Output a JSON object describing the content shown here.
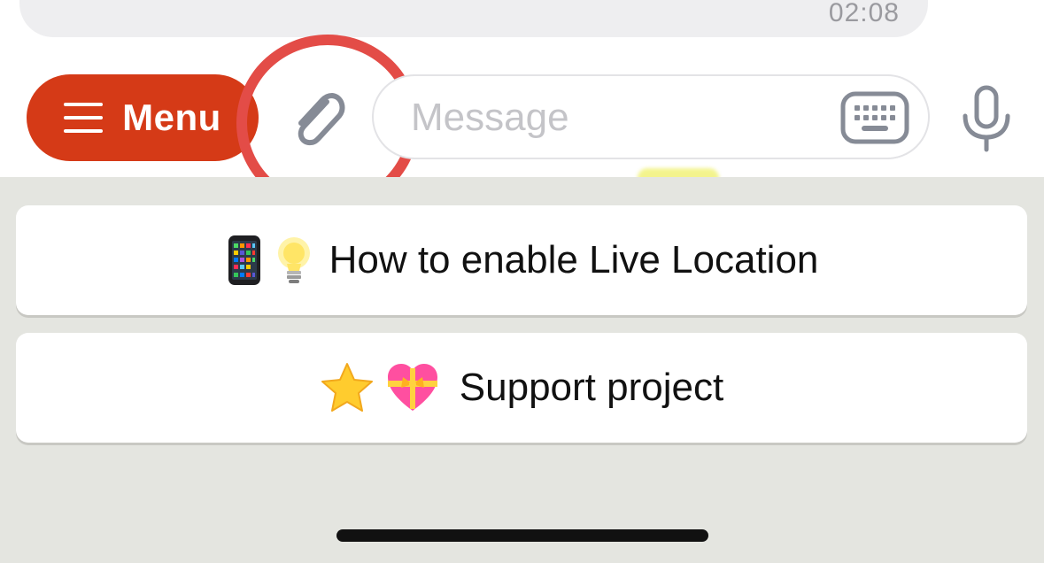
{
  "previous_message": {
    "time": "02:08"
  },
  "input_bar": {
    "menu_label": "Menu",
    "menu_icon": "hamburger-icon",
    "attach_icon": "paperclip-icon",
    "message_placeholder": "Message",
    "message_value": "",
    "keyboard_icon": "keyboard-icon",
    "mic_icon": "microphone-icon",
    "menu_color": "#d53a17",
    "highlight_color": "#e34c47"
  },
  "reply_keyboard": {
    "buttons": [
      {
        "emoji": [
          "mobile-phone-emoji",
          "light-bulb-emoji"
        ],
        "label": "How to enable Live Location"
      },
      {
        "emoji": [
          "star-emoji",
          "heart-with-ribbon-emoji"
        ],
        "label": "Support project"
      }
    ]
  }
}
